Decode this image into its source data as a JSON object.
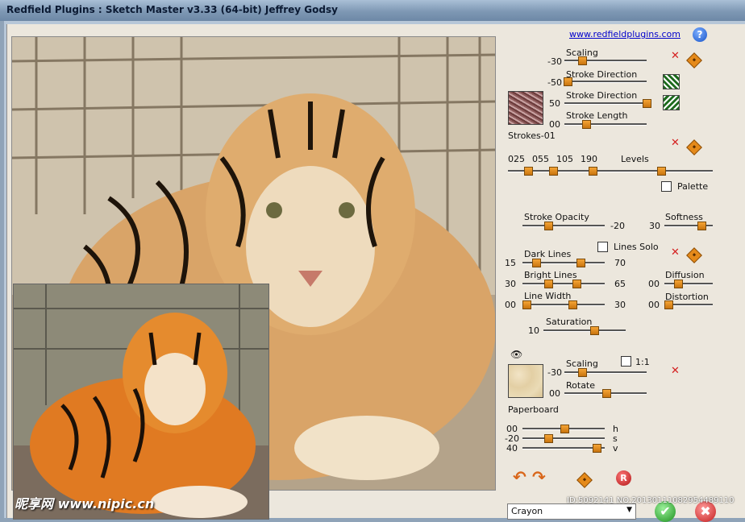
{
  "window": {
    "title": "Redfield Plugins : Sketch Master v3.33 (64-bit)    Jeffrey Godsy"
  },
  "link": "www.redfieldplugins.com",
  "strokes": {
    "scaling": {
      "label": "Scaling",
      "value": "-30"
    },
    "direction1": {
      "label": "Stroke Direction",
      "value": "-50"
    },
    "direction2": {
      "label": "Stroke Direction",
      "value": "50"
    },
    "length": {
      "label": "Stroke Length",
      "value": "00"
    },
    "preset": "Strokes-01"
  },
  "levels": {
    "label": "Levels",
    "values": [
      "025",
      "055",
      "105",
      "190"
    ],
    "palette_label": "Palette"
  },
  "opacity": {
    "stroke_label": "Stroke Opacity",
    "stroke_value": "-20",
    "softness_value": "30",
    "softness_label": "Softness"
  },
  "lines": {
    "solo_label": "Lines Solo",
    "dark_label": "Dark Lines",
    "dark_min": "15",
    "dark_max": "70",
    "bright_label": "Bright Lines",
    "bright_min": "30",
    "bright_max": "65",
    "width_label": "Line Width",
    "width_min": "00",
    "width_max": "30",
    "diffusion_label": "Diffusion",
    "diffusion_value": "00",
    "distortion_label": "Distortion",
    "distortion_value": "00",
    "saturation_label": "Saturation",
    "saturation_value": "10"
  },
  "paper": {
    "scaling_label": "Scaling",
    "scaling_value": "-30",
    "ratio_label": "1:1",
    "rotate_label": "Rotate",
    "rotate_value": "00",
    "preset": "Paperboard",
    "h_value": "00",
    "h_label": "h",
    "s_value": "-20",
    "s_label": "s",
    "v_value": "40",
    "v_label": "v"
  },
  "preset_select": "Crayon",
  "watermark": {
    "left": "昵享网 www.nipic.cn",
    "right": "ID:5092141 NO:20130111082954489110"
  },
  "icons": [
    "help-icon",
    "close-icon",
    "randomize-icon",
    "eye-icon",
    "undo-icon",
    "redo-icon",
    "reset-icon",
    "ok-icon",
    "cancel-icon"
  ]
}
